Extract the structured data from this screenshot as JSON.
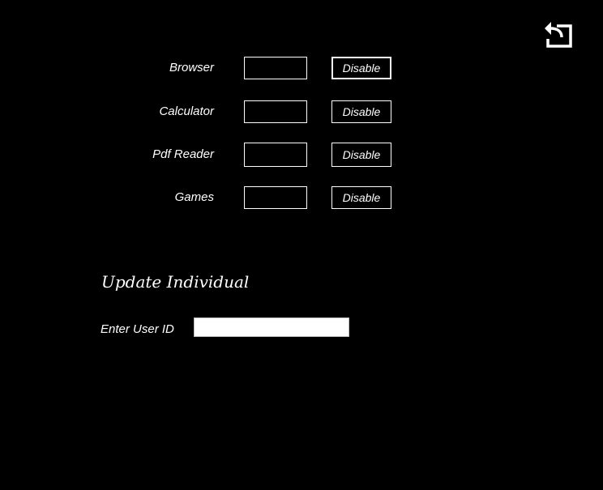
{
  "apps": [
    {
      "label": "Browser",
      "value": "",
      "button_label": "Disable"
    },
    {
      "label": "Calculator",
      "value": "",
      "button_label": "Disable"
    },
    {
      "label": "Pdf Reader",
      "value": "",
      "button_label": "Disable"
    },
    {
      "label": "Games",
      "value": "",
      "button_label": "Disable"
    }
  ],
  "back_icon": "return-arrow-icon",
  "update_section": {
    "heading": "Update Individual",
    "user_id_label": "Enter User ID",
    "user_id_value": ""
  },
  "colors": {
    "background": "#000000",
    "foreground": "#ffffff"
  }
}
